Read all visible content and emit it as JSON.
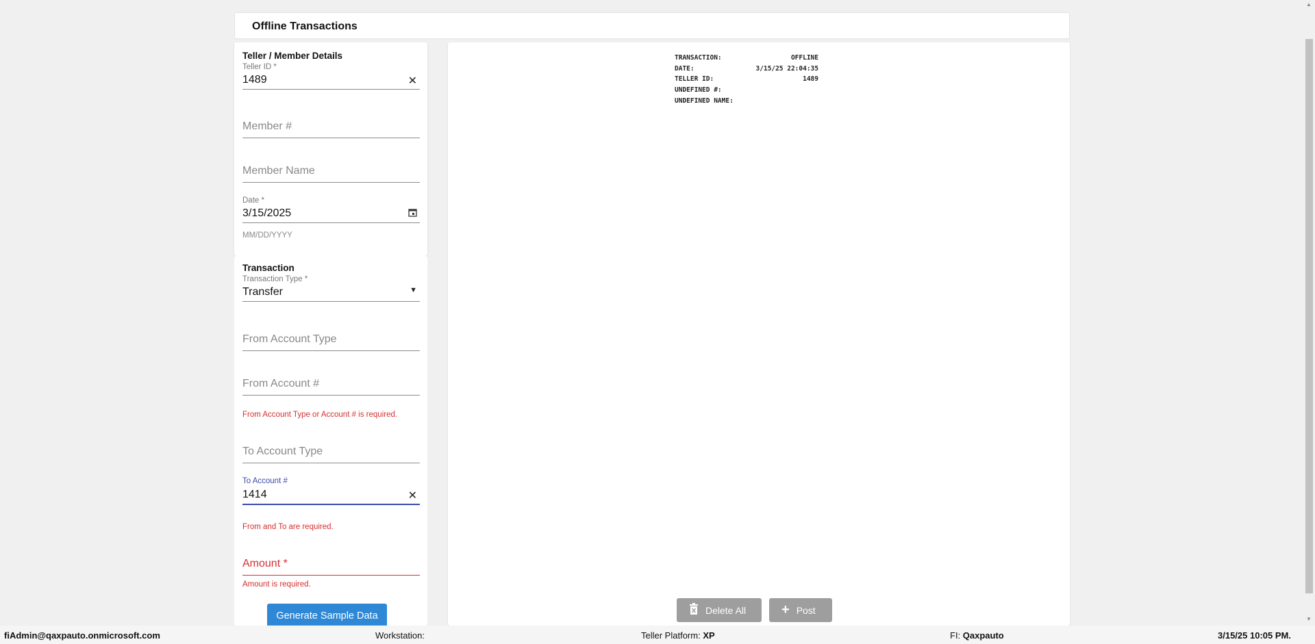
{
  "header": {
    "title": "Offline Transactions"
  },
  "teller_section": {
    "title": "Teller / Member Details",
    "teller_id": {
      "label": "Teller ID *",
      "value": "1489"
    },
    "member_number": {
      "placeholder": "Member #"
    },
    "member_name": {
      "placeholder": "Member Name"
    },
    "date": {
      "label": "Date *",
      "value": "3/15/2025",
      "helper": "MM/DD/YYYY"
    }
  },
  "transaction_section": {
    "title": "Transaction",
    "transaction_type": {
      "label": "Transaction Type *",
      "value": "Transfer"
    },
    "from_account_type": {
      "placeholder": "From Account Type"
    },
    "from_account_number": {
      "placeholder": "From Account #",
      "error": "From Account Type or Account # is required."
    },
    "to_account_type": {
      "placeholder": "To Account Type"
    },
    "to_account_number": {
      "label": "To Account #",
      "value": "1414",
      "error": "From and To are required."
    },
    "amount": {
      "placeholder": "Amount *",
      "error": "Amount is required."
    },
    "generate_button": "Generate Sample Data"
  },
  "receipt": {
    "rows": [
      {
        "key": "TRANSACTION:",
        "value": "OFFLINE"
      },
      {
        "key": "DATE:",
        "value": "3/15/25 22:04:35"
      },
      {
        "key": "TELLER ID:",
        "value": "1489"
      },
      {
        "key": "UNDEFINED #:",
        "value": ""
      },
      {
        "key": "UNDEFINED NAME:",
        "value": ""
      }
    ]
  },
  "actions": {
    "delete_all": "Delete All",
    "post": "Post"
  },
  "icons": {
    "clear": "close-icon",
    "calendar": "calendar-icon",
    "dropdown": "chevron-down-icon",
    "trash": "trash-icon",
    "plus": "plus-icon"
  },
  "colors": {
    "primary_button": "#2f88d6",
    "error": "#d32f2f",
    "focus": "#3949ab",
    "disabled_button": "#9e9e9e"
  },
  "status_bar": {
    "user": "fiAdmin@qaxpauto.onmicrosoft.com",
    "workstation_label": "Workstation:",
    "workstation_value": "",
    "platform_label": "Teller Platform:",
    "platform_value": "XP",
    "fi_label": "FI:",
    "fi_value": "Qaxpauto",
    "datetime": "3/15/25 10:05 PM."
  }
}
